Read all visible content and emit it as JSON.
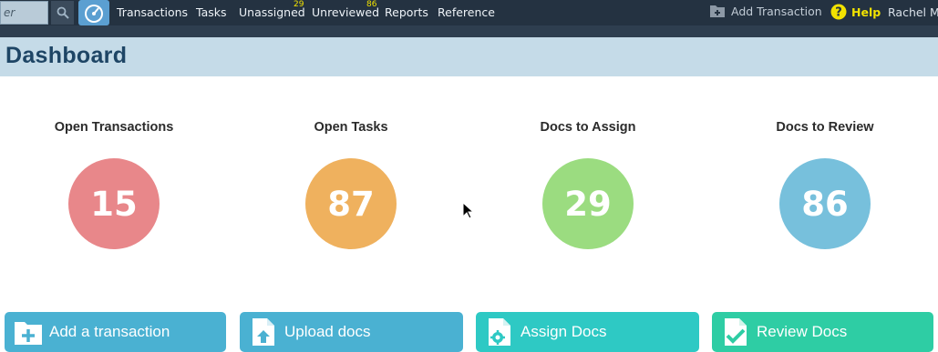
{
  "nav": {
    "search_text": "er",
    "links": [
      {
        "label": "Transactions",
        "badge": ""
      },
      {
        "label": "Tasks",
        "badge": ""
      },
      {
        "label": "Unassigned",
        "badge": "29"
      },
      {
        "label": "Unreviewed",
        "badge": "86"
      },
      {
        "label": "Reports",
        "badge": ""
      },
      {
        "label": "Reference",
        "badge": ""
      }
    ],
    "add_transaction": "Add Transaction",
    "help": "Help",
    "user": "Rachel M."
  },
  "page": {
    "title": "Dashboard"
  },
  "stats": [
    {
      "label": "Open Transactions",
      "value": "15",
      "color": "#e8878a"
    },
    {
      "label": "Open Tasks",
      "value": "87",
      "color": "#efb15e"
    },
    {
      "label": "Docs to Assign",
      "value": "29",
      "color": "#9bdc80"
    },
    {
      "label": "Docs to Review",
      "value": "86",
      "color": "#77c0dc"
    }
  ],
  "actions": [
    {
      "label": "Add a transaction",
      "icon": "folder-plus-icon",
      "color": "#4ab1d2"
    },
    {
      "label": "Upload docs",
      "icon": "file-upload-icon",
      "color": "#4ab1d2"
    },
    {
      "label": "Assign Docs",
      "icon": "file-gear-icon",
      "color": "#2ec9c4"
    },
    {
      "label": "Review Docs",
      "icon": "file-check-icon",
      "color": "#2ecda4"
    }
  ],
  "colors": {
    "nav_bg": "#243241",
    "title_bg": "#c5dbe8",
    "title_text": "#1e4565",
    "help": "#f2e200"
  }
}
